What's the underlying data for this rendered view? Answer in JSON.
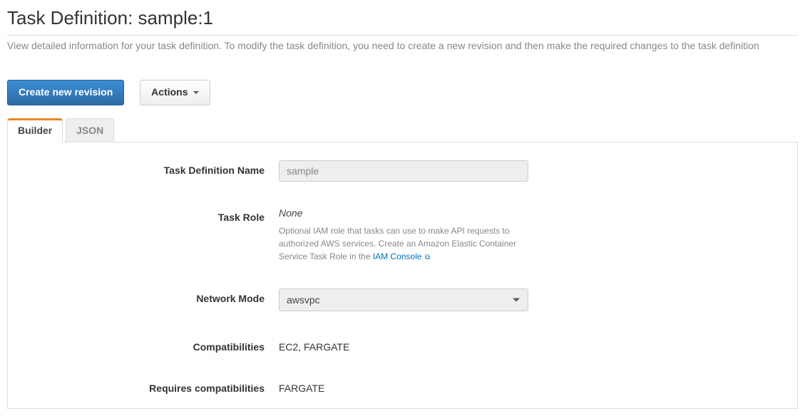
{
  "header": {
    "title": "Task Definition: sample:1",
    "description": "View detailed information for your task definition. To modify the task definition, you need to create a new revision and then make the required changes to the task definition"
  },
  "buttons": {
    "create_revision": "Create new revision",
    "actions": "Actions"
  },
  "tabs": {
    "builder": "Builder",
    "json": "JSON"
  },
  "form": {
    "task_definition_name": {
      "label": "Task Definition Name",
      "value": "sample"
    },
    "task_role": {
      "label": "Task Role",
      "value": "None",
      "help_prefix": "Optional IAM role that tasks can use to make API requests to authorized AWS services. Create an Amazon Elastic Container Service Task Role in the ",
      "help_link": "IAM Console"
    },
    "network_mode": {
      "label": "Network Mode",
      "value": "awsvpc"
    },
    "compatibilities": {
      "label": "Compatibilities",
      "value": "EC2, FARGATE"
    },
    "requires_compatibilities": {
      "label": "Requires compatibilities",
      "value": "FARGATE"
    }
  }
}
